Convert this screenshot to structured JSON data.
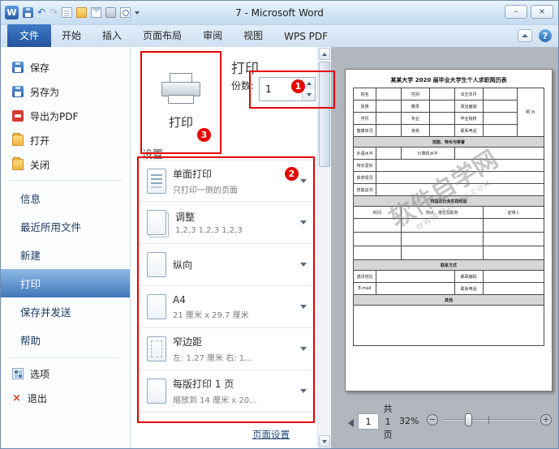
{
  "titlebar": {
    "title": "7 -  Microsoft Word",
    "qat_icons": [
      "word-logo",
      "save",
      "undo",
      "redo",
      "new-document",
      "open-folder",
      "email",
      "print",
      "print-preview",
      "qat-menu"
    ],
    "logo_glyph": "W",
    "undo_glyph": "↶",
    "redo_glyph": "↷",
    "minimize_glyph": "–",
    "close_glyph": "×"
  },
  "ribbon": {
    "tabs": [
      {
        "label": "文件",
        "active": true
      },
      {
        "label": "开始"
      },
      {
        "label": "插入"
      },
      {
        "label": "页面布局"
      },
      {
        "label": "审阅"
      },
      {
        "label": "视图"
      },
      {
        "label": "WPS PDF"
      }
    ],
    "help_glyph": "?"
  },
  "sidebar": {
    "file_actions": [
      {
        "label": "保存",
        "icon": "save-icon"
      },
      {
        "label": "另存为",
        "icon": "save-as-icon"
      },
      {
        "label": "导出为PDF",
        "icon": "pdf-icon"
      },
      {
        "label": "打开",
        "icon": "open-folder-icon"
      },
      {
        "label": "关闭",
        "icon": "close-file-icon"
      }
    ],
    "tabs": [
      {
        "label": "信息"
      },
      {
        "label": "最近所用文件"
      },
      {
        "label": "新建"
      },
      {
        "label": "打印",
        "active": true
      },
      {
        "label": "保存并发送"
      },
      {
        "label": "帮助"
      }
    ],
    "bottom_actions": [
      {
        "label": "选项",
        "icon": "options-icon"
      },
      {
        "label": "退出",
        "icon": "exit-icon",
        "glyph": "×"
      }
    ]
  },
  "print_panel": {
    "big_button_label": "打印",
    "heading": "打印",
    "copies_label": "份数:",
    "copies_value": "1",
    "settings_heading": "设置",
    "settings": [
      {
        "title": "单面打印",
        "subtitle": "只打印一侧的页面",
        "icon": "duplex-icon"
      },
      {
        "title": "调整",
        "subtitle": "1,2,3    1,2,3    1,2,3",
        "icon": "collate-icon"
      },
      {
        "title": "纵向",
        "subtitle": "",
        "icon": "orientation-icon"
      },
      {
        "title": "A4",
        "subtitle": "21 厘米 x 29.7 厘米",
        "icon": "paper-size-icon"
      },
      {
        "title": "窄边距",
        "subtitle": "左: 1.27 厘米   右: 1...",
        "icon": "margins-icon"
      },
      {
        "title": "每版打印 1 页",
        "subtitle": "缩放到 14 厘米 x 20...",
        "icon": "pages-per-sheet-icon"
      }
    ],
    "page_setup_link": "页面设置"
  },
  "annotations": {
    "badge_copies": "1",
    "badge_settings": "2",
    "badge_print": "3"
  },
  "preview": {
    "watermark_main": "软件自学网",
    "watermark_sub": "WWW.RJZXW.COM",
    "nav": {
      "page_value": "1",
      "total_label": "共 1 页",
      "zoom_value": "32%",
      "zoom_out_glyph": "−",
      "zoom_in_glyph": "+"
    },
    "document": {
      "title": "某某大学 2020 届毕业大学生个人求职简历表",
      "table_rows": [
        [
          {
            "t": "姓名"
          },
          {
            "t": ""
          },
          {
            "t": "性别"
          },
          {
            "t": ""
          },
          {
            "t": "出生年月"
          },
          {
            "t": ""
          },
          {
            "t": "照 片",
            "rs": 4
          }
        ],
        [
          {
            "t": "民族"
          },
          {
            "t": ""
          },
          {
            "t": "籍贯"
          },
          {
            "t": ""
          },
          {
            "t": "政治面貌"
          },
          {
            "t": ""
          }
        ],
        [
          {
            "t": "学历"
          },
          {
            "t": ""
          },
          {
            "t": "专业"
          },
          {
            "t": ""
          },
          {
            "t": "毕业院校"
          },
          {
            "t": ""
          }
        ],
        [
          {
            "t": "健康状况"
          },
          {
            "t": ""
          },
          {
            "t": "身高"
          },
          {
            "t": ""
          },
          {
            "t": "联系电话"
          },
          {
            "t": ""
          }
        ],
        [
          {
            "t": "技能、特长与荣誉",
            "c": "sec",
            "cs": 7
          }
        ],
        [
          {
            "t": "外语水平"
          },
          {
            "t": ""
          },
          {
            "t": "计算机水平",
            "cs": 2
          },
          {
            "t": "",
            "cs": 3
          }
        ],
        [
          {
            "t": "特长爱好"
          },
          {
            "t": "",
            "cs": 6
          }
        ],
        [
          {
            "t": "获奖情况"
          },
          {
            "t": "",
            "cs": 6
          }
        ],
        [
          {
            "t": "技能证书"
          },
          {
            "t": "",
            "cs": 6
          }
        ],
        [
          {
            "t": "校园及社会实践经验",
            "c": "sec",
            "cs": 7
          }
        ],
        [
          {
            "t": "时间",
            "cs": 2
          },
          {
            "t": "地点、单位及职务",
            "cs": 3
          },
          {
            "t": "证明人",
            "cs": 2
          }
        ],
        [
          {
            "t": "",
            "cs": 2,
            "c": "exp"
          },
          {
            "t": "",
            "cs": 3,
            "c": "exp"
          },
          {
            "t": "",
            "cs": 2,
            "c": "exp"
          }
        ],
        [
          {
            "t": "",
            "cs": 2,
            "c": "exp"
          },
          {
            "t": "",
            "cs": 3,
            "c": "exp"
          },
          {
            "t": "",
            "cs": 2,
            "c": "exp"
          }
        ],
        [
          {
            "t": "",
            "cs": 2,
            "c": "exp"
          },
          {
            "t": "",
            "cs": 3,
            "c": "exp"
          },
          {
            "t": "",
            "cs": 2,
            "c": "exp"
          }
        ],
        [
          {
            "t": "联系方式",
            "c": "sec",
            "cs": 7
          }
        ],
        [
          {
            "t": "通讯地址"
          },
          {
            "t": "",
            "cs": 3
          },
          {
            "t": "邮政编码"
          },
          {
            "t": "",
            "cs": 2
          }
        ],
        [
          {
            "t": "E-mail"
          },
          {
            "t": "",
            "cs": 3
          },
          {
            "t": "联系电话"
          },
          {
            "t": "",
            "cs": 2
          }
        ],
        [
          {
            "t": "其他",
            "c": "sec",
            "cs": 7
          }
        ],
        [
          {
            "t": "",
            "cs": 7,
            "c": "tall"
          }
        ]
      ]
    }
  }
}
